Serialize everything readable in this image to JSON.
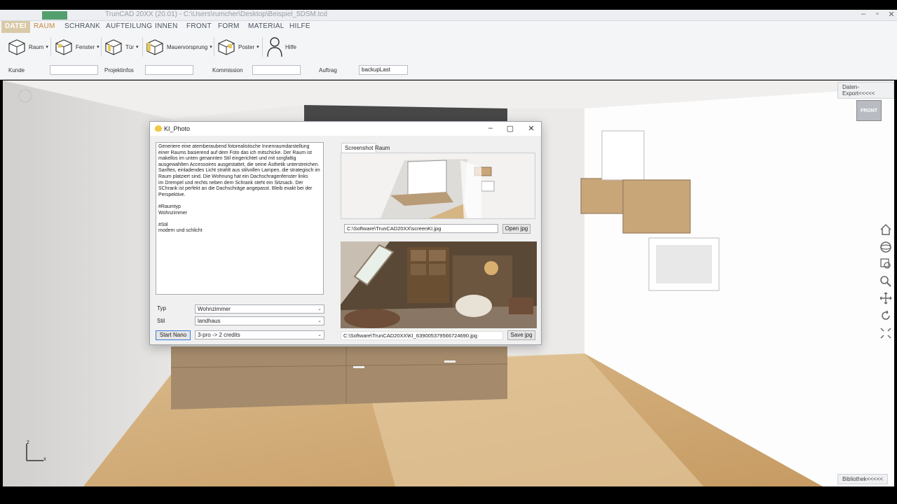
{
  "window": {
    "title": "TrunCAD 20XX (20.01) - C:\\Users\\rumcher\\Desktop\\Beispiel_5DSM.tcd"
  },
  "menu": {
    "items": [
      "DATEI",
      "RAUM",
      "SCHRANK",
      "AUFTEILUNG",
      "INNEN",
      "FRONT",
      "FORM",
      "MATERIAL",
      "HILFE"
    ],
    "active": "RAUM"
  },
  "ribbon": {
    "buttons": [
      {
        "label": "Raum",
        "icon": "room-box-icon"
      },
      {
        "label": "Fenster",
        "icon": "window-box-icon"
      },
      {
        "label": "Tür",
        "icon": "door-box-icon"
      },
      {
        "label": "Mauervorsprung",
        "icon": "wall-projection-icon"
      },
      {
        "label": "Poster",
        "icon": "poster-box-icon"
      },
      {
        "label": "Hilfe",
        "icon": "help-person-icon"
      }
    ],
    "fields": [
      {
        "label": "Kunde",
        "value": ""
      },
      {
        "label": "Projektinfos",
        "value": ""
      },
      {
        "label": "Kommission",
        "value": ""
      },
      {
        "label": "Auftrag",
        "value": "backupLast"
      }
    ]
  },
  "viewport": {
    "export_tab": "Daten-Export<<<<<",
    "library_tab": "Bibliothek<<<<<",
    "cube_label": "FRONT",
    "axis_z": "z",
    "axis_x": "x"
  },
  "dialog": {
    "title": "KI_Photo",
    "prompt": "Generiere eine atemberaubend fotorealistische Innenraumdarstellung einer Raums basierend auf dem Foto das ich mitschicke. Der Raum ist makellos im unten genannten Stil eingerichtet und mit sorgfaltig ausgewahlten Accessoires ausgestattet, die seine Ästhetik unterstreichen. Sanftes, einladendes Licht strahlt aus stilvollen Lampen, die strategisch im Raum platziert sind. Die Wohnung hat ein Dachschragenfenster links\nim Drempel und rechts neben dem Schrank steht ein Sitzsack. Der SChrank ist perfekt an die Dachschräge angepasst. Bleib exakt bei der Perspektive.\n\n#Raumtyp\nWohnzimmer\n\n#Stil\nmodern und schlicht",
    "typ_label": "Typ",
    "typ_value": "Wohnzimmer",
    "stil_label": "Stil",
    "stil_value": "landhaus",
    "start_button": "Start Nano",
    "credits_value": "3-pro -> 2 credits",
    "tab_screenshot": "Screenshot",
    "tab_raum": "Raum",
    "screenshot_path": "C:\\Software\\TrunCAD20XX\\screenKI.jpg",
    "open_button": "Open jpg",
    "result_path": "C:\\Software\\TrunCAD20XX\\KI_639005379566724690.jpg",
    "save_button": "Save jpg"
  }
}
